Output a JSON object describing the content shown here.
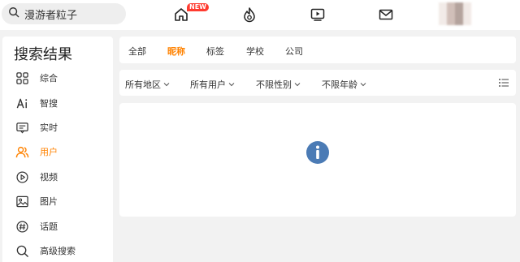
{
  "header": {
    "search": {
      "value": "漫游者粒子",
      "placeholder": ""
    },
    "nav": [
      {
        "name": "home",
        "badge": "NEW"
      },
      {
        "name": "hot"
      },
      {
        "name": "video"
      },
      {
        "name": "messages"
      }
    ]
  },
  "sidebar": {
    "title": "搜索结果",
    "items": [
      {
        "label": "综合",
        "icon": "grid-icon"
      },
      {
        "label": "智搜",
        "icon": "ai-icon"
      },
      {
        "label": "实时",
        "icon": "realtime-icon"
      },
      {
        "label": "用户",
        "icon": "users-icon",
        "active": true
      },
      {
        "label": "视频",
        "icon": "play-icon"
      },
      {
        "label": "图片",
        "icon": "image-icon"
      },
      {
        "label": "话题",
        "icon": "hashtag-icon"
      },
      {
        "label": "高级搜索",
        "icon": "search-icon"
      }
    ]
  },
  "tabs": [
    {
      "label": "全部"
    },
    {
      "label": "昵称",
      "active": true
    },
    {
      "label": "标签"
    },
    {
      "label": "学校"
    },
    {
      "label": "公司"
    }
  ],
  "filters": [
    {
      "label": "所有地区"
    },
    {
      "label": "所有用户"
    },
    {
      "label": "不限性别"
    },
    {
      "label": "不限年龄"
    }
  ],
  "colors": {
    "accent": "#ff8200",
    "info": "#4b7bb5",
    "badge": "#ff3b30"
  }
}
